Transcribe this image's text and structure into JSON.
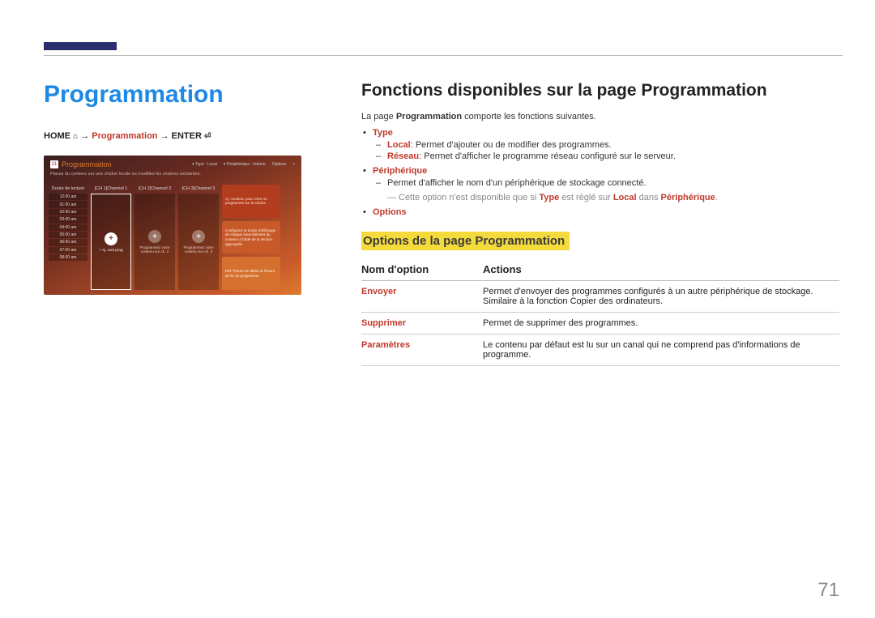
{
  "page_number": "71",
  "left": {
    "title": "Programmation",
    "breadcrumb": {
      "home": "HOME",
      "item": "Programmation",
      "enter": "ENTER",
      "arrow": "→"
    },
    "screenshot": {
      "calendar_day": "31",
      "title": "Programmation",
      "toolbar": {
        "type_label": "Type : Local",
        "device_label": "Périphérique : Interne",
        "options_label": "Options",
        "close": "×"
      },
      "subtitle": "Placez du contenu sur une chaîne locale ou modifiez les chaînes existantes.",
      "time_header": "Durée de lecture",
      "times": [
        "12:00 am",
        "01:00 am",
        "02:00 am",
        "03:00 am",
        "04:00 am",
        "05:00 am",
        "06:00 am",
        "07:00 am",
        "08:00 am"
      ],
      "channels": [
        {
          "head": "[CH 1]Channel 1",
          "label": "+ Aj. cont prog",
          "selected": true
        },
        {
          "head": "[CH 2]Channel 2",
          "label": "Programmez votre contenu sur ch. 2",
          "selected": false
        },
        {
          "head": "[CH 3]Channel 3",
          "label": "Programmez votre contenu sur ch. 3",
          "selected": false
        }
      ],
      "help": [
        "Aj. contenu: pour créer un programme sur la chaîne",
        "Configurez la durée d'affichage de chaque sous-élément du contenu à l'aide de la section appropriée",
        "Déf. l'heure de début et l'heure de fin du programme"
      ]
    }
  },
  "right": {
    "heading": "Fonctions disponibles sur la page Programmation",
    "intro_pre": "La page ",
    "intro_bold": "Programmation",
    "intro_post": " comporte les fonctions suivantes.",
    "features": {
      "type": {
        "label": "Type",
        "local_key": "Local",
        "local_desc": ": Permet d'ajouter ou de modifier des programmes.",
        "reseau_key": "Réseau",
        "reseau_desc": ": Permet d'afficher le programme réseau configuré sur le serveur."
      },
      "periph": {
        "label": "Périphérique",
        "desc": "Permet d'afficher le nom d'un périphérique de stockage connecté.",
        "note_pre": "Cette option n'est disponible que si ",
        "note_k1": "Type",
        "note_mid": " est réglé sur ",
        "note_k2": "Local",
        "note_mid2": " dans ",
        "note_k3": "Périphérique",
        "note_post": "."
      },
      "options": {
        "label": "Options"
      }
    },
    "subheading": "Options de la page Programmation",
    "table": {
      "col1": "Nom d'option",
      "col2": "Actions",
      "rows": [
        {
          "name": "Envoyer",
          "action": "Permet d'envoyer des programmes configurés à un autre périphérique de stockage. Similaire à la fonction Copier des ordinateurs."
        },
        {
          "name": "Supprimer",
          "action": "Permet de supprimer des programmes."
        },
        {
          "name": "Paramètres",
          "action": "Le contenu par défaut est lu sur un canal qui ne comprend pas d'informations de programme."
        }
      ]
    }
  }
}
